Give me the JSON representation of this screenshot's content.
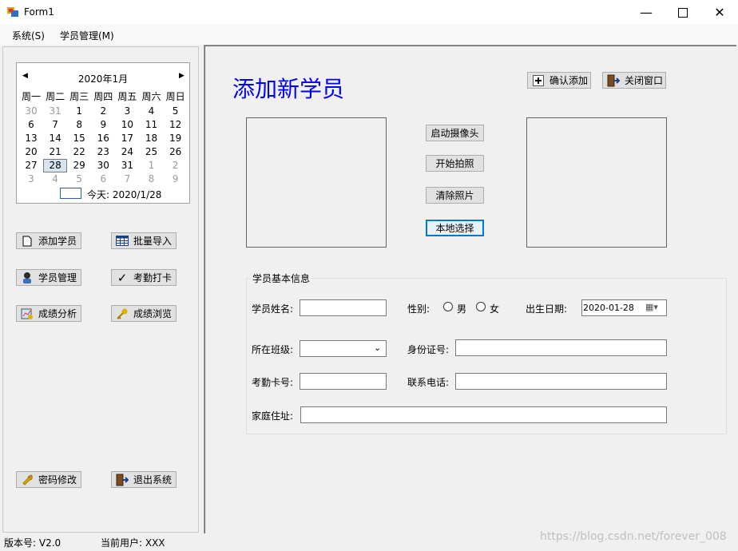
{
  "window": {
    "title": "Form1"
  },
  "menu": {
    "items": [
      "系统(S)",
      "学员管理(M)"
    ]
  },
  "calendar": {
    "month_label": "2020年1月",
    "weekdays": [
      "周一",
      "周二",
      "周三",
      "周四",
      "周五",
      "周六",
      "周日"
    ],
    "rows": [
      [
        "30",
        "31",
        "1",
        "2",
        "3",
        "4",
        "5"
      ],
      [
        "6",
        "7",
        "8",
        "9",
        "10",
        "11",
        "12"
      ],
      [
        "13",
        "14",
        "15",
        "16",
        "17",
        "18",
        "19"
      ],
      [
        "20",
        "21",
        "22",
        "23",
        "24",
        "25",
        "26"
      ],
      [
        "27",
        "28",
        "29",
        "30",
        "31",
        "1",
        "2"
      ],
      [
        "3",
        "4",
        "5",
        "6",
        "7",
        "8",
        "9"
      ]
    ],
    "today_label": "今天: 2020/1/28",
    "selected_day": "28"
  },
  "sidebar": {
    "add_student": "添加学员",
    "batch_import": "批量导入",
    "student_manage": "学员管理",
    "attendance": "考勤打卡",
    "score_analysis": "成绩分析",
    "score_browse": "成绩浏览",
    "change_password": "密码修改",
    "exit_system": "退出系统"
  },
  "form": {
    "title": "添加新学员",
    "confirm_add": "确认添加",
    "close_window": "关闭窗口",
    "start_camera": "启动摄像头",
    "take_photo": "开始拍照",
    "clear_photo": "清除照片",
    "local_select": "本地选择",
    "group_title": "学员基本信息",
    "name_label": "学员姓名:",
    "gender_label": "性别:",
    "male": "男",
    "female": "女",
    "birth_label": "出生日期:",
    "birth_value": "2020-01-28",
    "class_label": "所在班级:",
    "id_label": "身份证号:",
    "card_label": "考勤卡号:",
    "phone_label": "联系电话:",
    "address_label": "家庭住址:"
  },
  "status": {
    "version": "版本号: V2.0",
    "user": "当前用户: XXX",
    "watermark": "https://blog.csdn.net/forever_008"
  },
  "colors": {
    "title_blue": "#0000ff",
    "focus_blue": "#0078d7"
  }
}
